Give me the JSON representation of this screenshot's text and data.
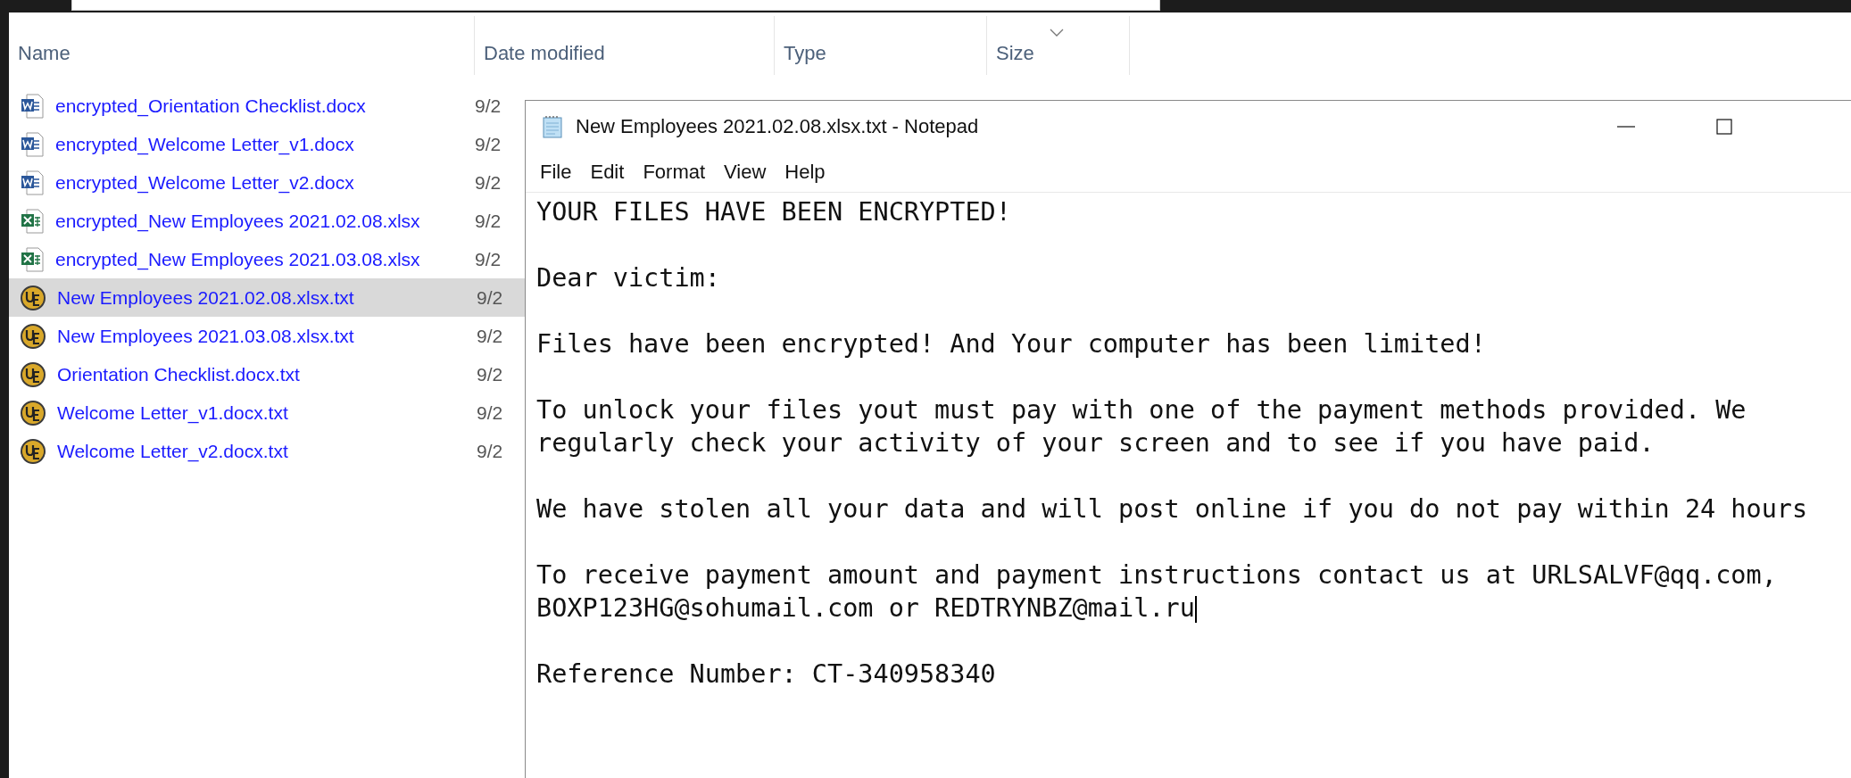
{
  "explorer": {
    "columns": [
      {
        "label": "Name",
        "sorted": false
      },
      {
        "label": "Date modified",
        "sorted": false
      },
      {
        "label": "Type",
        "sorted": false
      },
      {
        "label": "Size",
        "sorted": true
      }
    ],
    "files": [
      {
        "name": "encrypted_Orientation Checklist.docx",
        "date": "9/2",
        "kind": "word",
        "selected": false
      },
      {
        "name": "encrypted_Welcome Letter_v1.docx",
        "date": "9/2",
        "kind": "word",
        "selected": false
      },
      {
        "name": "encrypted_Welcome Letter_v2.docx",
        "date": "9/2",
        "kind": "word",
        "selected": false
      },
      {
        "name": "encrypted_New Employees 2021.02.08.xlsx",
        "date": "9/2",
        "kind": "excel",
        "selected": false
      },
      {
        "name": "encrypted_New Employees 2021.03.08.xlsx",
        "date": "9/2",
        "kind": "excel",
        "selected": false
      },
      {
        "name": "New Employees 2021.02.08.xlsx.txt",
        "date": "9/2",
        "kind": "text",
        "selected": true
      },
      {
        "name": "New Employees 2021.03.08.xlsx.txt",
        "date": "9/2",
        "kind": "text",
        "selected": false
      },
      {
        "name": "Orientation Checklist.docx.txt",
        "date": "9/2",
        "kind": "text",
        "selected": false
      },
      {
        "name": "Welcome Letter_v1.docx.txt",
        "date": "9/2",
        "kind": "text",
        "selected": false
      },
      {
        "name": "Welcome Letter_v2.docx.txt",
        "date": "9/2",
        "kind": "text",
        "selected": false
      }
    ]
  },
  "notepad": {
    "title": "New Employees 2021.02.08.xlsx.txt - Notepad",
    "menu": [
      "File",
      "Edit",
      "Format",
      "View",
      "Help"
    ],
    "paragraphs": [
      {
        "lines": [
          "YOUR FILES HAVE BEEN ENCRYPTED!"
        ],
        "cursor": false
      },
      {
        "lines": [
          "Dear victim:"
        ],
        "cursor": false
      },
      {
        "lines": [
          "Files have been encrypted! And Your computer has been limited!"
        ],
        "cursor": false
      },
      {
        "lines": [
          "To unlock your files yout must pay with one of the payment methods provided. We",
          "regularly check your activity of your screen and to see if you have paid."
        ],
        "cursor": false
      },
      {
        "lines": [
          "We have stolen all your data and will post online if you do not pay within 24 hours"
        ],
        "cursor": false
      },
      {
        "lines": [
          "To receive payment amount and payment instructions contact us at URLSALVF@qq.com,",
          "BOXP123HG@sohumail.com or REDTRYNBZ@mail.ru"
        ],
        "cursor": true
      },
      {
        "lines": [
          "Reference Number: CT-340958340"
        ],
        "cursor": false
      }
    ]
  }
}
